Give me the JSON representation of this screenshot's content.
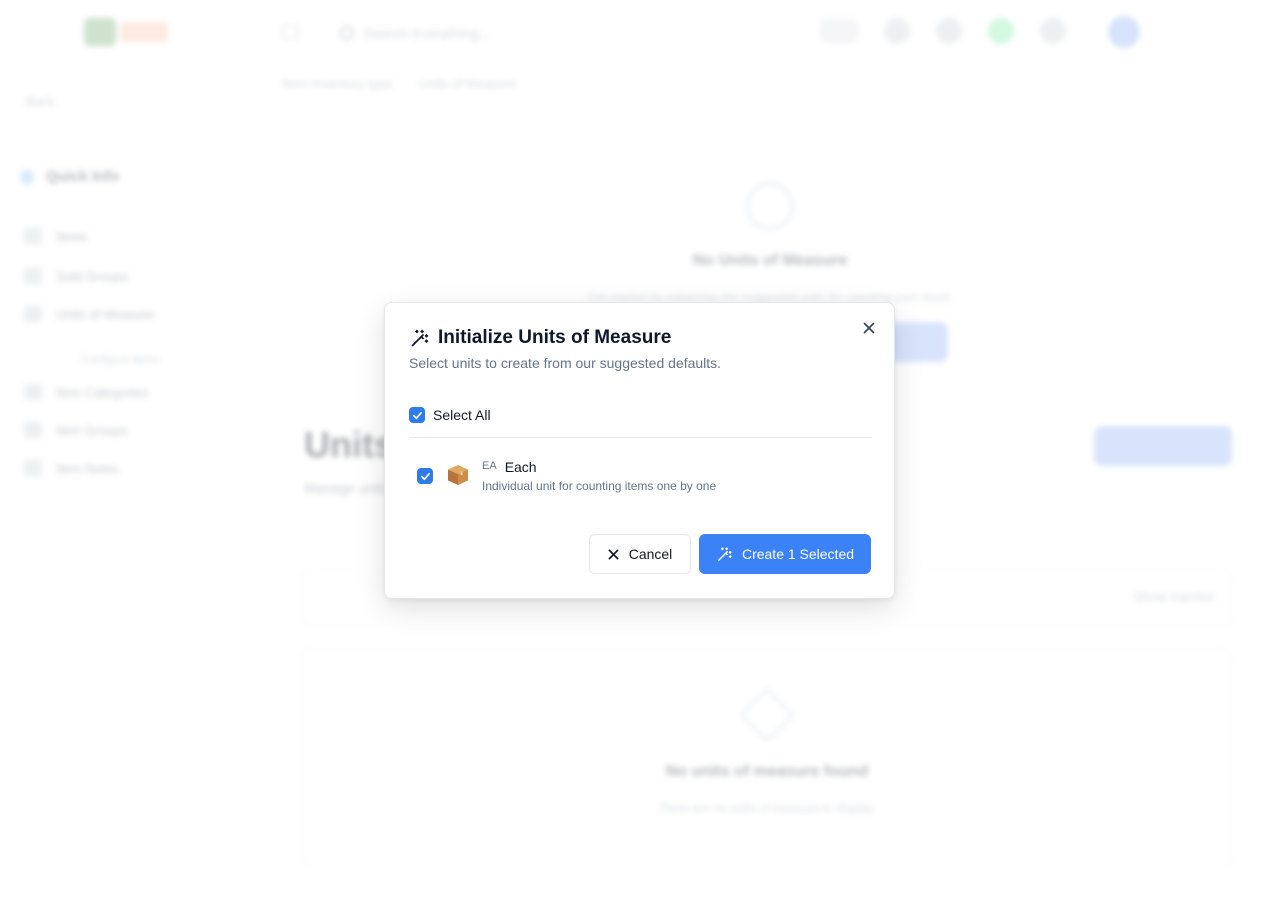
{
  "app": {
    "search_placeholder": "Search Everything...",
    "sidebar": {
      "back": "Back",
      "section": "Quick Info",
      "items": [
        "Items",
        "Sold Groups",
        "Units of Measure",
        "Item Categories",
        "Item Groups",
        "Item Notes"
      ],
      "sub_label": "Configure items"
    },
    "breadcrumb": [
      "Item Inventory type",
      "Units of Measure"
    ],
    "empty_top": {
      "title": "No Units of Measure",
      "description": "Get started by initializing the suggested units for counting your stock."
    },
    "page_title": "Units of Measure",
    "page_subtitle": "Manage units",
    "filter_right": "Show Inactive",
    "empty_list": {
      "title": "No units of measure found",
      "description": "There are no units of measure to display."
    }
  },
  "modal": {
    "title": "Initialize Units of Measure",
    "description": "Select units to create from our suggested defaults.",
    "select_all_label": "Select All",
    "select_all_checked": true,
    "units": [
      {
        "code": "EA",
        "name": "Each",
        "description": "Individual unit for counting items one by one",
        "icon": "package-box-icon",
        "checked": true
      }
    ],
    "cancel_label": "Cancel",
    "create_label": "Create 1 Selected",
    "colors": {
      "primary": "#3b82f6",
      "checkbox": "#2f7ce8"
    }
  }
}
